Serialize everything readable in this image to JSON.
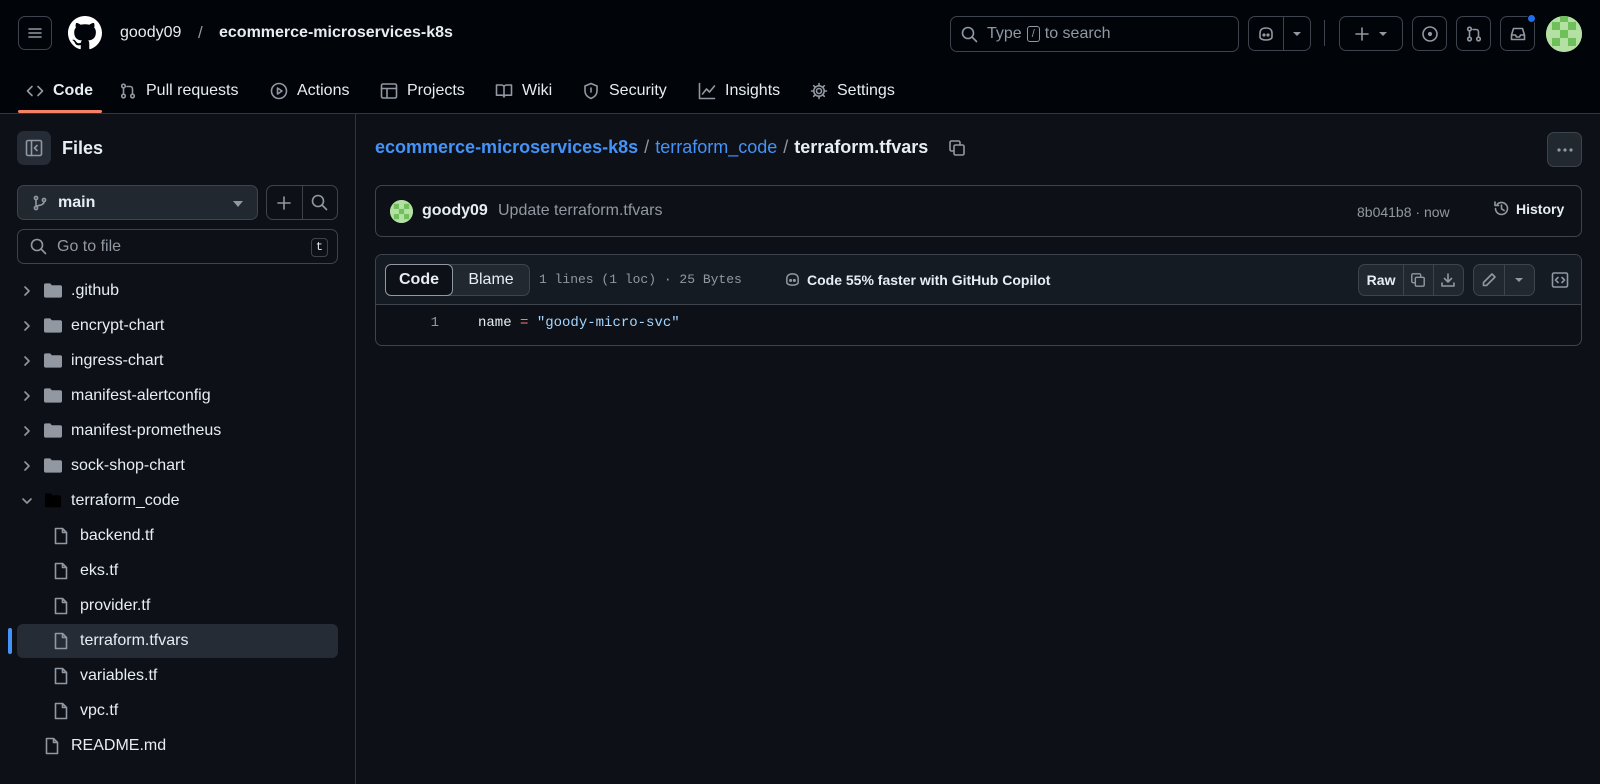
{
  "header": {
    "owner": "goody09",
    "separator": "/",
    "repo": "ecommerce-microservices-k8s",
    "search": {
      "prefix": "Type",
      "key": "/",
      "suffix": "to search"
    }
  },
  "repo_nav": {
    "tabs": [
      {
        "label": "Code",
        "icon": "code-icon",
        "selected": true
      },
      {
        "label": "Pull requests",
        "icon": "git-pull-request-icon"
      },
      {
        "label": "Actions",
        "icon": "play-icon"
      },
      {
        "label": "Projects",
        "icon": "table-icon"
      },
      {
        "label": "Wiki",
        "icon": "book-icon"
      },
      {
        "label": "Security",
        "icon": "shield-icon"
      },
      {
        "label": "Insights",
        "icon": "graph-icon"
      },
      {
        "label": "Settings",
        "icon": "gear-icon"
      }
    ]
  },
  "sidebar": {
    "title": "Files",
    "branch": "main",
    "goto_placeholder": "Go to file",
    "goto_shortcut": "t",
    "tree": [
      {
        "name": ".github",
        "type": "folder",
        "expanded": false
      },
      {
        "name": "encrypt-chart",
        "type": "folder",
        "expanded": false
      },
      {
        "name": "ingress-chart",
        "type": "folder",
        "expanded": false
      },
      {
        "name": "manifest-alertconfig",
        "type": "folder",
        "expanded": false
      },
      {
        "name": "manifest-prometheus",
        "type": "folder",
        "expanded": false
      },
      {
        "name": "sock-shop-chart",
        "type": "folder",
        "expanded": false
      },
      {
        "name": "terraform_code",
        "type": "folder",
        "expanded": true
      },
      {
        "name": "backend.tf",
        "type": "file",
        "depth": 1
      },
      {
        "name": "eks.tf",
        "type": "file",
        "depth": 1
      },
      {
        "name": "provider.tf",
        "type": "file",
        "depth": 1
      },
      {
        "name": "terraform.tfvars",
        "type": "file",
        "depth": 1,
        "selected": true
      },
      {
        "name": "variables.tf",
        "type": "file",
        "depth": 1
      },
      {
        "name": "vpc.tf",
        "type": "file",
        "depth": 1
      },
      {
        "name": "README.md",
        "type": "file",
        "depth": 0
      }
    ]
  },
  "breadcrumb": {
    "repo": "ecommerce-microservices-k8s",
    "folder": "terraform_code",
    "file": "terraform.tfvars",
    "sep": "/"
  },
  "commit": {
    "author": "goody09",
    "message": "Update terraform.tfvars",
    "meta": "8b041b8 · now",
    "history_label": "History"
  },
  "file_view": {
    "tab_code": "Code",
    "tab_blame": "Blame",
    "info": "1 lines (1 loc) · 25 Bytes",
    "copilot_hint": "Code 55% faster with GitHub Copilot",
    "raw_label": "Raw",
    "lines": [
      {
        "number": "1",
        "key": "name",
        "op": "=",
        "value": "\"goody-micro-svc\""
      }
    ]
  },
  "colors": {
    "accent_blue": "#4493f8",
    "tab_underline": "#f78166",
    "bg": "#0d1117"
  }
}
